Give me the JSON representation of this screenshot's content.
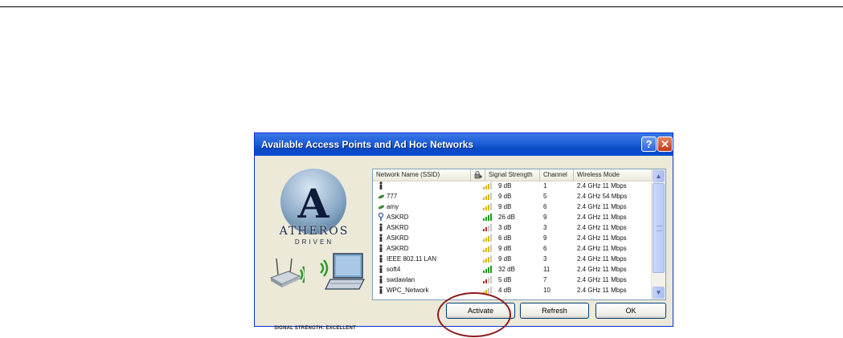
{
  "window": {
    "title": "Available Access Points and Ad Hoc Networks",
    "help_label": "?",
    "close_label": "✕"
  },
  "branding": {
    "logo_letter": "A",
    "logo_word": "ATHEROS",
    "logo_sub": "DRIVEN",
    "signal_strength_label": "SIGNAL STRENGTH: EXCELLENT"
  },
  "table": {
    "columns": [
      "Network Name (SSID)",
      "",
      "Signal Strength",
      "Channel",
      "Wireless Mode"
    ],
    "rows": [
      {
        "icon": "person-icon",
        "name": "",
        "signal": "9 dB",
        "channel": "1",
        "mode": "2.4 GHz 11 Mbps",
        "level": 3,
        "color": "#d8b800"
      },
      {
        "icon": "adhoc-icon",
        "name": "777",
        "signal": "9 dB",
        "channel": "5",
        "mode": "2.4 GHz 54 Mbps",
        "level": 3,
        "color": "#d8b800"
      },
      {
        "icon": "adhoc-icon",
        "name": "amy",
        "signal": "9 dB",
        "channel": "6",
        "mode": "2.4 GHz 11 Mbps",
        "level": 3,
        "color": "#d8b800"
      },
      {
        "icon": "connected-icon",
        "name": "ASKRD",
        "signal": "26 dB",
        "channel": "9",
        "mode": "2.4 GHz 11 Mbps",
        "level": 4,
        "color": "#1e9a1e"
      },
      {
        "icon": "person-icon",
        "name": "ASKRD",
        "signal": "3 dB",
        "channel": "3",
        "mode": "2.4 GHz 11 Mbps",
        "level": 2,
        "color": "#b03020"
      },
      {
        "icon": "person-icon",
        "name": "ASKRD",
        "signal": "6 dB",
        "channel": "9",
        "mode": "2.4 GHz 11 Mbps",
        "level": 3,
        "color": "#d8b800"
      },
      {
        "icon": "person-icon",
        "name": "ASKRD",
        "signal": "9 dB",
        "channel": "6",
        "mode": "2.4 GHz 11 Mbps",
        "level": 3,
        "color": "#d8b800"
      },
      {
        "icon": "person-icon",
        "name": "IEEE 802.11 LAN",
        "signal": "9 dB",
        "channel": "3",
        "mode": "2.4 GHz 11 Mbps",
        "level": 3,
        "color": "#d8b800"
      },
      {
        "icon": "person-icon",
        "name": "soft4",
        "signal": "32 dB",
        "channel": "11",
        "mode": "2.4 GHz 11 Mbps",
        "level": 4,
        "color": "#1e9a1e"
      },
      {
        "icon": "person-icon",
        "name": "swdawlan",
        "signal": "5 dB",
        "channel": "7",
        "mode": "2.4 GHz 11 Mbps",
        "level": 2,
        "color": "#b03020"
      },
      {
        "icon": "person-icon",
        "name": "WPC_Network",
        "signal": "4 dB",
        "channel": "10",
        "mode": "2.4 GHz 11 Mbps",
        "level": 2,
        "color": "#d8b800"
      }
    ]
  },
  "buttons": {
    "activate": "Activate",
    "refresh": "Refresh",
    "ok": "OK"
  },
  "annotation": {
    "color": "#8b1a1a"
  }
}
